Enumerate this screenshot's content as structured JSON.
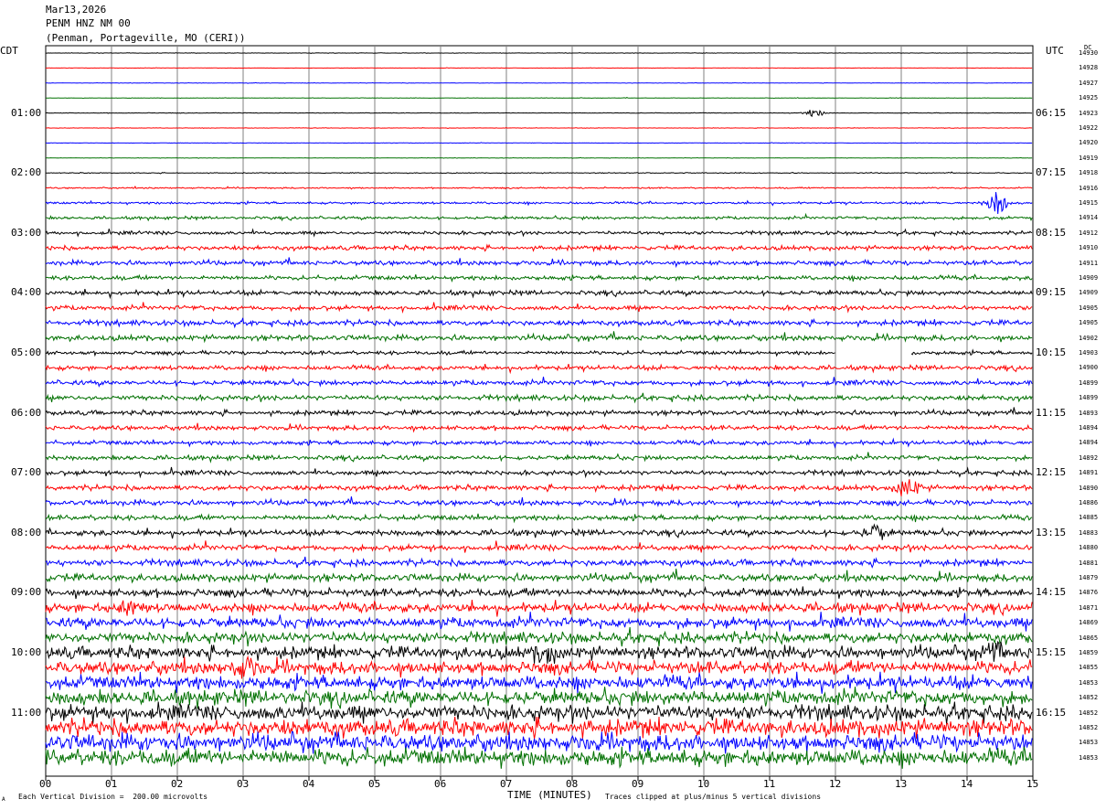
{
  "header": {
    "date": "Mar13,2026",
    "station": "PENM HNZ NM 00",
    "location": "(Penman, Portageville, MO (CERI))"
  },
  "left_zone": "CDT",
  "right_zone": "UTC",
  "dc_label": "DC",
  "footer": {
    "scale": "Each Vertical Division =  200.00 microvolts",
    "xlabel": "TIME (MINUTES)",
    "clip_note": "Traces clipped at plus/minus 5 vertical divisions",
    "corner_mark": "A"
  },
  "colors": {
    "trace_cycle": [
      "#000000",
      "#ff0000",
      "#0000ff",
      "#007000"
    ],
    "grid": "#808080",
    "frame": "#000000"
  },
  "chart_data": {
    "type": "line",
    "title": "PENM HNZ NM 00",
    "xlabel": "TIME (MINUTES)",
    "xlim": [
      0,
      15
    ],
    "x_ticks": [
      "00",
      "01",
      "02",
      "03",
      "04",
      "05",
      "06",
      "07",
      "08",
      "09",
      "10",
      "11",
      "12",
      "13",
      "14",
      "15"
    ],
    "left_hour_labels": [
      "01:00",
      "02:00",
      "03:00",
      "04:00",
      "05:00",
      "06:00",
      "07:00",
      "08:00",
      "09:00",
      "10:00",
      "11:00"
    ],
    "right_hour_labels": [
      "06:15",
      "07:15",
      "08:15",
      "09:15",
      "10:15",
      "11:15",
      "12:15",
      "13:15",
      "14:15",
      "15:15",
      "16:15"
    ],
    "trace_count": 48,
    "dc_offsets": [
      14930,
      14928,
      14927,
      14925,
      14923,
      14922,
      14920,
      14919,
      14918,
      14916,
      14915,
      14914,
      14912,
      14910,
      14911,
      14909,
      14909,
      14905,
      14905,
      14902,
      14903,
      14900,
      14899,
      14899,
      14893,
      14894,
      14894,
      14892,
      14891,
      14890,
      14886,
      14885,
      14883,
      14880,
      14881,
      14879,
      14876,
      14871,
      14869,
      14865,
      14859,
      14855,
      14853,
      14852,
      14852,
      14852,
      14853,
      14853
    ],
    "trace_activity": [
      0.15,
      0.12,
      0.15,
      0.15,
      0.2,
      0.15,
      0.15,
      0.15,
      0.3,
      0.5,
      0.8,
      1.0,
      1.2,
      1.5,
      1.6,
      1.5,
      1.6,
      1.6,
      1.8,
      1.9,
      1.3,
      1.6,
      1.7,
      1.8,
      1.6,
      1.6,
      1.5,
      1.6,
      1.6,
      1.8,
      1.8,
      1.8,
      2.0,
      2.0,
      2.2,
      2.6,
      2.8,
      3.2,
      3.6,
      3.8,
      4.2,
      4.5,
      4.8,
      5.0,
      5.2,
      5.8,
      5.8,
      5.8
    ],
    "gap": {
      "trace_index": 20,
      "x_start": 12.0,
      "x_end": 13.15
    },
    "events": [
      {
        "trace_index": 4,
        "x": 11.7,
        "amp": 3
      },
      {
        "trace_index": 10,
        "x": 14.45,
        "amp": 10
      },
      {
        "trace_index": 29,
        "x": 13.1,
        "amp": 9
      },
      {
        "trace_index": 32,
        "x": 12.6,
        "amp": 6
      },
      {
        "trace_index": 37,
        "x": 1.3,
        "amp": 7
      },
      {
        "trace_index": 40,
        "x": 7.6,
        "amp": 7
      },
      {
        "trace_index": 40,
        "x": 14.4,
        "amp": 7
      },
      {
        "trace_index": 41,
        "x": 3.0,
        "amp": 9
      }
    ]
  }
}
